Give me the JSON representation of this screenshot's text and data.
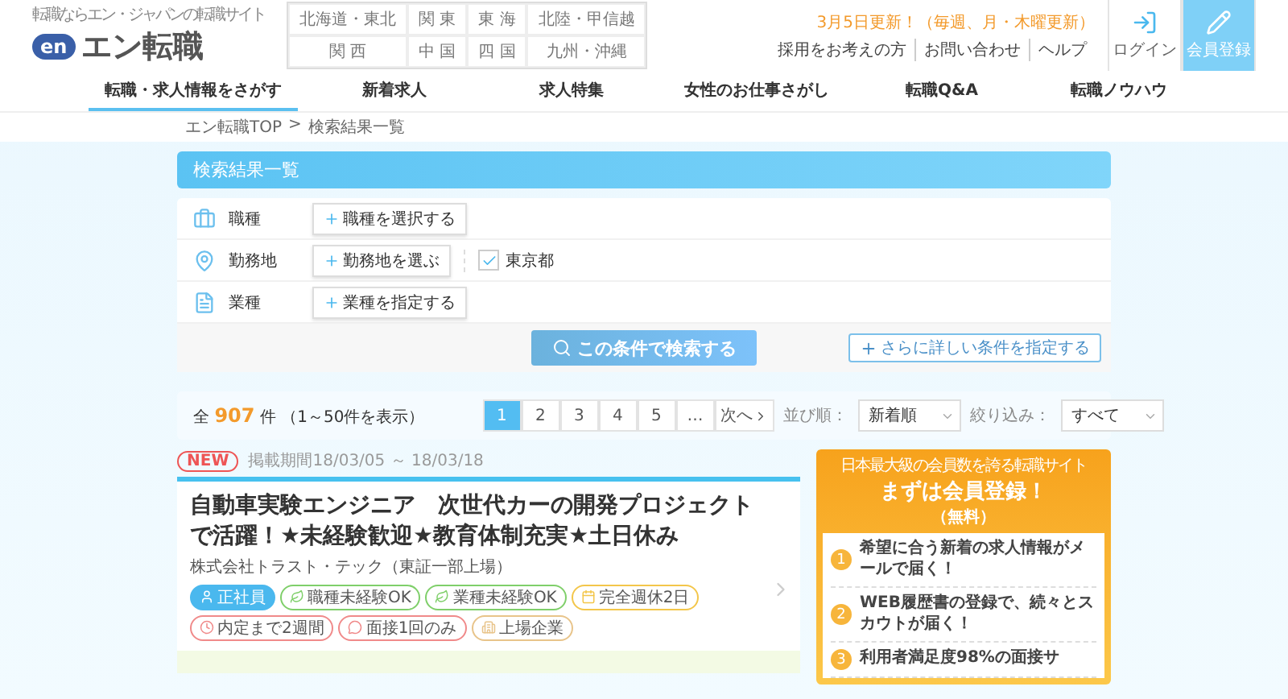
{
  "header": {
    "tagline": "転職ならエン・ジャパンの転職サイト",
    "logo_badge": "en",
    "logo_text": "エン転職",
    "regions": [
      "北海道・東北",
      "関 東",
      "東 海",
      "北陸・甲信越",
      "関 西",
      "中 国",
      "四 国",
      "九州・沖縄"
    ],
    "update_notice": "3月5日更新！（毎週、月・木曜更新）",
    "links": [
      "採用をお考えの方",
      "お問い合わせ",
      "ヘルプ"
    ],
    "buttons": [
      {
        "label": "ログイン",
        "kind": "login"
      },
      {
        "label": "会員登録",
        "kind": "register"
      }
    ]
  },
  "nav": [
    {
      "label": "転職・求人情報をさがす",
      "selected": true
    },
    {
      "label": "新着求人",
      "selected": false
    },
    {
      "label": "求人特集",
      "selected": false
    },
    {
      "label": "女性のお仕事さがし",
      "selected": false
    },
    {
      "label": "転職Q&A",
      "selected": false
    },
    {
      "label": "転職ノウハウ",
      "selected": false
    }
  ],
  "breadcrumb": {
    "items": [
      "エン転職TOP",
      "検索結果一覧"
    ],
    "separator": ">"
  },
  "results_title": "検索結果一覧",
  "search_panel": {
    "rows": [
      {
        "kind": "job",
        "label": "職種",
        "button": "職種を選択する",
        "chips": []
      },
      {
        "kind": "location",
        "label": "勤務地",
        "button": "勤務地を選ぶ",
        "chips": [
          {
            "label": "東京都",
            "checked": true
          }
        ]
      },
      {
        "kind": "industry",
        "label": "業種",
        "button": "業種を指定する",
        "chips": []
      }
    ],
    "search_button": "この条件で検索する",
    "more_button": "さらに詳しい条件を指定する"
  },
  "results_bar": {
    "prefix": "全",
    "count": "907",
    "suffix": "件",
    "range": "（1～50件を表示）",
    "pages": [
      {
        "label": "1",
        "selected": true
      },
      {
        "label": "2",
        "selected": false
      },
      {
        "label": "3",
        "selected": false
      },
      {
        "label": "4",
        "selected": false
      },
      {
        "label": "5",
        "selected": false
      },
      {
        "label": "…",
        "selected": false
      }
    ],
    "next": "次へ",
    "sort_label": "並び順：",
    "sort_value": "新着順",
    "filter_label": "絞り込み：",
    "filter_value": "すべて"
  },
  "jobs": [
    {
      "new_badge": "NEW",
      "period": "掲載期間18/03/05 ～ 18/03/18",
      "title": "自動車実験エンジニア　次世代カーの開発プロジェクトで活躍！★未経験歓迎★教育体制充実★土日休み",
      "company": "株式会社トラスト・テック（東証一部上場）",
      "tags": [
        {
          "label": "正社員",
          "kind": "employment",
          "color": "#4ab8ee"
        },
        {
          "label": "職種未経験OK",
          "kind": "beginner",
          "color": "#7fcf6a"
        },
        {
          "label": "業種未経験OK",
          "kind": "beginner",
          "color": "#7fcf6a"
        },
        {
          "label": "完全週休2日",
          "kind": "holiday",
          "color": "#f3c64a"
        },
        {
          "label": "内定まで2週間",
          "kind": "speed",
          "color": "#f08a8a"
        },
        {
          "label": "面接1回のみ",
          "kind": "interview",
          "color": "#f08a8a"
        },
        {
          "label": "上場企業",
          "kind": "listed",
          "color": "#e8c48a"
        }
      ]
    }
  ],
  "sidebar": {
    "subtitle": "日本最大級の会員数を誇る転職サイト",
    "title": "まずは会員登録！",
    "note": "（無料）",
    "items": [
      {
        "number": "1",
        "text": "希望に合う新着の求人情報がメールで届く！"
      },
      {
        "number": "2",
        "text": "WEB履歴書の登録で、続々とスカウトが届く！"
      },
      {
        "number": "3",
        "text": "利用者満足度98%の面接サ"
      }
    ]
  }
}
